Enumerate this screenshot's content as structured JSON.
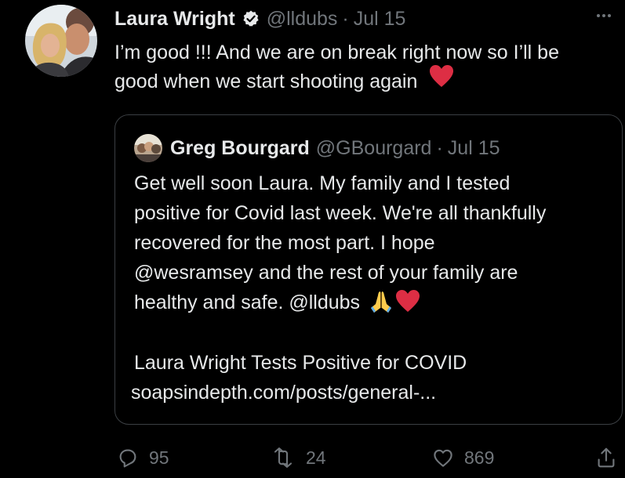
{
  "author": {
    "display_name": "Laura Wright",
    "handle": "@lldubs",
    "date": "Jul 15",
    "separator": "·",
    "verified": true
  },
  "tweet": {
    "lines": [
      "I’m good !!! And we are on  break right now so I’ll be",
      "good when we start shooting  again"
    ],
    "emoji": "red-heart"
  },
  "quote": {
    "display_name": "Greg Bourgard",
    "handle": "@GBourgard",
    "separator": "·",
    "date": "Jul 15",
    "lines": [
      "Get well soon Laura. My family and I tested",
      "positive for Covid last week. We're all thankfully",
      "recovered for the most part. I hope",
      "@wesramsey  and the rest of your family are",
      "healthy and safe. @lldubs"
    ],
    "emojis": [
      "folded-hands",
      "red-heart"
    ],
    "link_title": "Laura Wright Tests Positive for COVID",
    "link_url": "soapsindepth.com/posts/general-..."
  },
  "actions": {
    "reply_count": "95",
    "retweet_count": "24",
    "like_count": "869"
  },
  "colors": {
    "background": "#000000",
    "text": "#e7e9ea",
    "muted": "#71767b",
    "heart": "#e0245e",
    "border": "#3b3f43"
  }
}
